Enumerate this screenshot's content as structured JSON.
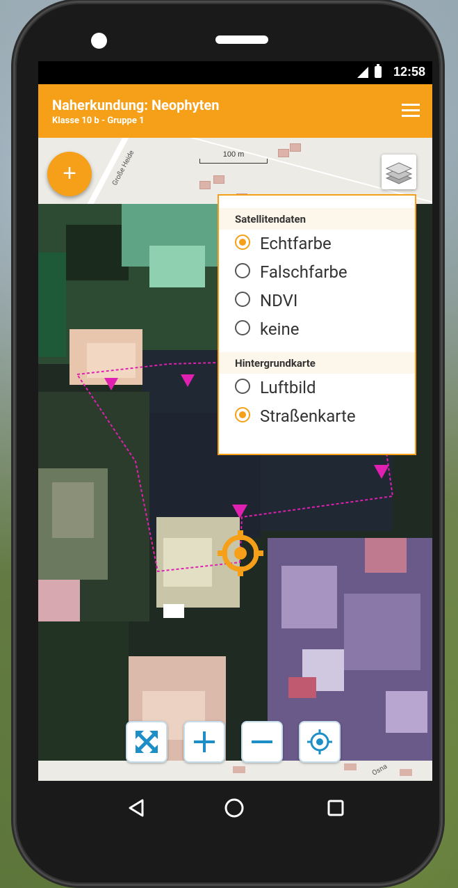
{
  "status_bar": {
    "time": "12:58"
  },
  "app_bar": {
    "title": "Naherkundung: Neophyten",
    "subtitle": "Klasse 10 b - Gruppe 1",
    "menu_icon": "hamburger-menu-icon"
  },
  "map": {
    "scale_label": "100 m",
    "street_name_top": "Große Heide",
    "street_name_bottom": "Osna"
  },
  "layer_panel": {
    "satellite_heading": "Satellitendaten",
    "satellite_options": [
      {
        "label": "Echtfarbe",
        "selected": true
      },
      {
        "label": "Falschfarbe",
        "selected": false
      },
      {
        "label": "NDVI",
        "selected": false
      },
      {
        "label": "keine",
        "selected": false
      }
    ],
    "background_heading": "Hintergrundkarte",
    "background_options": [
      {
        "label": "Luftbild",
        "selected": false
      },
      {
        "label": "Straßenkarte",
        "selected": true
      }
    ]
  },
  "colors": {
    "accent": "#f5a018",
    "marker": "#e020b0",
    "control_border": "#c5ddeb",
    "control_icon": "#1e8fc6"
  },
  "controls": {
    "add_icon": "plus-icon",
    "layers_icon": "layers-icon",
    "fullscreen_icon": "fullscreen-icon",
    "zoom_in_icon": "zoom-in-icon",
    "zoom_out_icon": "zoom-out-icon",
    "locate_icon": "locate-icon"
  },
  "nav": [
    "back",
    "home",
    "recents"
  ]
}
